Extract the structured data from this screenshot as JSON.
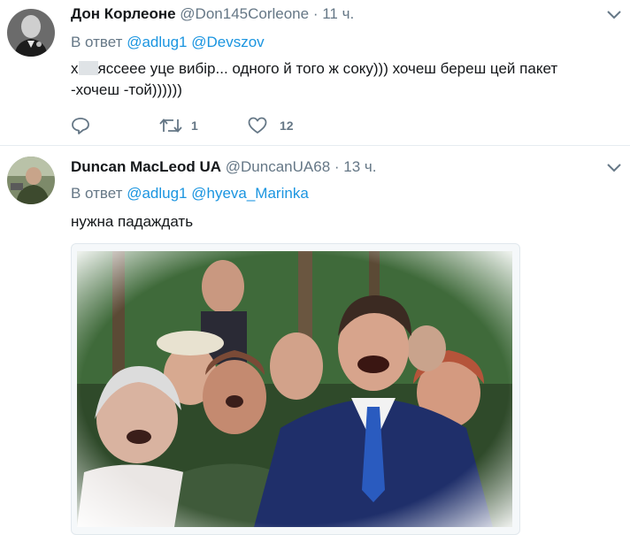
{
  "tweets": [
    {
      "name": "Дон Корлеоне",
      "handle": "@Don145Corleone",
      "separator": "·",
      "time": "11 ч.",
      "reply_prefix": "В ответ",
      "mentions": [
        "@adlug1",
        "@Devszov"
      ],
      "text_start": "х",
      "text_rest": "яссеее  уце вибір... одного й того ж соку))) хочеш береш цей пакет -хочеш -той))))))",
      "retweet_count": "1",
      "like_count": "12"
    },
    {
      "name": "Duncan MacLeod UA",
      "handle": "@DuncanUA68",
      "separator": "·",
      "time": "13 ч.",
      "reply_prefix": "В ответ",
      "mentions": [
        "@adlug1",
        "@hyeva_Marinka"
      ],
      "text": "нужна падаждать"
    }
  ],
  "icons": [
    "chevron-down-icon",
    "reply-icon",
    "retweet-icon",
    "like-icon"
  ],
  "colors": {
    "link": "#1b95e0",
    "muted": "#657786",
    "divider": "#e6ecf0"
  }
}
